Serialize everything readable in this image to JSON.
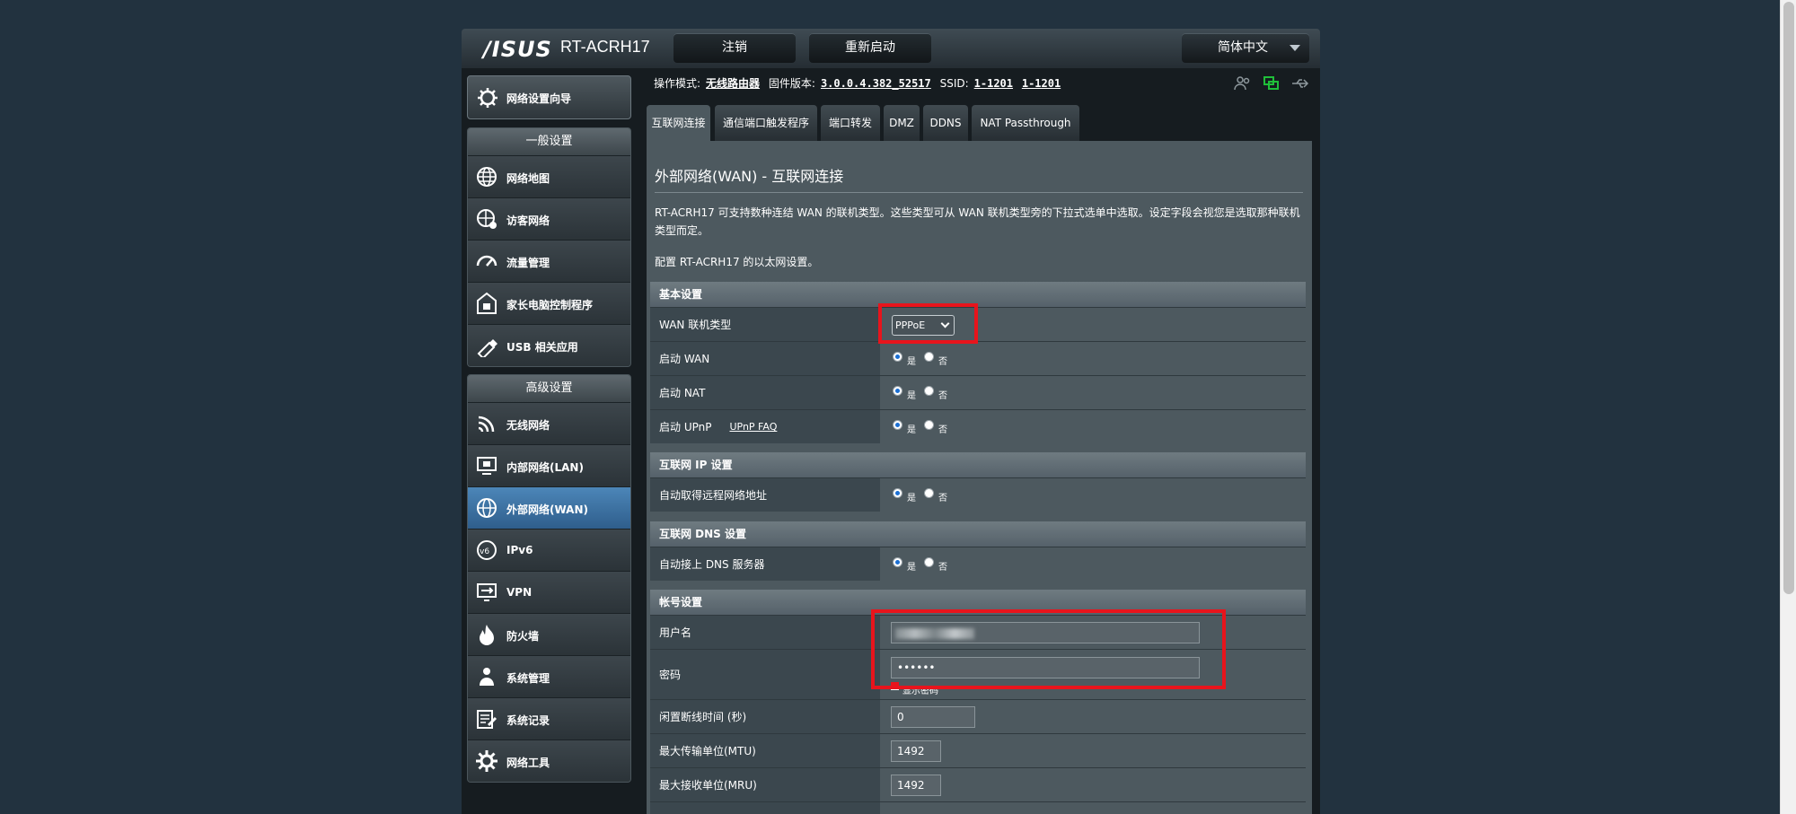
{
  "header": {
    "logo": "/ISUS",
    "model": "RT-ACRH17",
    "logout_label": "注销",
    "reboot_label": "重新启动",
    "language": "简体中文"
  },
  "sidebar": {
    "quick_setup": "网络设置向导",
    "general": {
      "title": "一般设置",
      "items": [
        "网络地图",
        "访客网络",
        "流量管理",
        "家长电脑控制程序",
        "USB 相关应用"
      ]
    },
    "advanced": {
      "title": "高级设置",
      "items": [
        "无线网络",
        "内部网络(LAN)",
        "外部网络(WAN)",
        "IPv6",
        "VPN",
        "防火墙",
        "系统管理",
        "系统记录",
        "网络工具"
      ],
      "active_index": 2
    }
  },
  "status": {
    "mode_label": "操作模式:",
    "mode_value": "无线路由器",
    "fw_label": "固件版本:",
    "fw_value": "3.0.0.4.382_52517",
    "ssid_label": "SSID:",
    "ssid_1": "1-1201",
    "ssid_2": "1-1201",
    "icons": [
      "users-icon",
      "network-status-icon",
      "usb-icon"
    ]
  },
  "tabs": [
    "互联网连接",
    "通信端口触发程序",
    "端口转发",
    "DMZ",
    "DDNS",
    "NAT Passthrough"
  ],
  "panel": {
    "title": "外部网络(WAN) - 互联网连接",
    "description": "RT-ACRH17 可支持数种连结 WAN 的联机类型。这些类型可从 WAN 联机类型旁的下拉式选单中选取。设定字段会视您是选取那种联机类型而定。",
    "config_note": "配置 RT-ACRH17 的以太网设置。",
    "yes": "是",
    "no": "否",
    "basic": {
      "head": "基本设置",
      "wan_type_label": "WAN 联机类型",
      "wan_type_value": "PPPoE",
      "enable_wan": "启动 WAN",
      "enable_nat": "启动 NAT",
      "enable_upnp": "启动 UPnP",
      "upnp_faq": "UPnP FAQ"
    },
    "ip": {
      "head": "互联网 IP 设置",
      "auto_ip": "自动取得远程网络地址"
    },
    "dns": {
      "head": "互联网 DNS 设置",
      "auto_dns": "自动接上 DNS 服务器"
    },
    "account": {
      "head": "帐号设置",
      "username_label": "用户名",
      "password_label": "密码",
      "password_value": "••••••",
      "show_password": "显示密码",
      "idle_label": "闲置断线时间 (秒)",
      "idle_value": "0",
      "mtu_label": "最大传输单位(MTU)",
      "mtu_value": "1492",
      "mru_label": "最大接收单位(MRU)",
      "mru_value": "1492"
    }
  },
  "colors": {
    "highlight_box": "#e8141c",
    "active_menu": "#3f76a8",
    "radio_selected": "#1b6fd3"
  }
}
